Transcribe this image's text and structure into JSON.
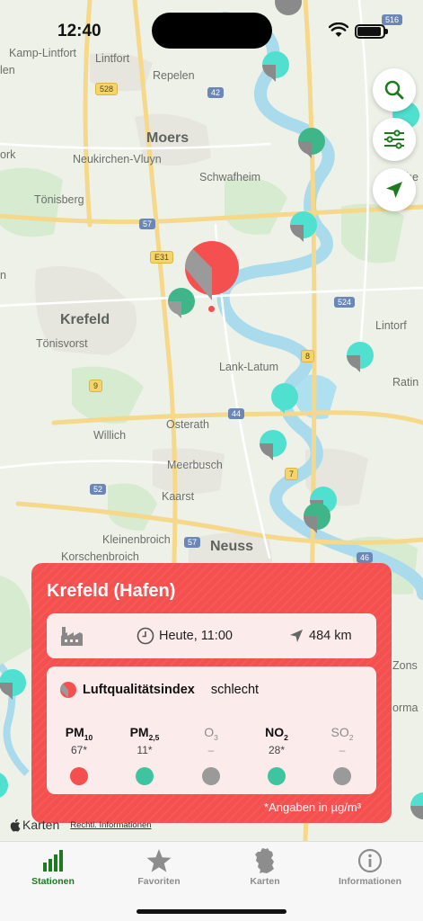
{
  "status_bar": {
    "time": "12:40"
  },
  "map": {
    "places": [
      {
        "name": "Kamp-Lintfort",
        "size": "small"
      },
      {
        "name": "Lintfort",
        "size": "small"
      },
      {
        "name": "Repelen",
        "size": "small"
      },
      {
        "name": "Moers",
        "size": "big"
      },
      {
        "name": "Neukirchen-Vluyn",
        "size": "small"
      },
      {
        "name": "Schwafheim",
        "size": "small"
      },
      {
        "name": "Tönisberg",
        "size": "small"
      },
      {
        "name": "Krefeld",
        "size": "big"
      },
      {
        "name": "Tönisvorst",
        "size": "small"
      },
      {
        "name": "Lank-Latum",
        "size": "small"
      },
      {
        "name": "Lintorf",
        "size": "small"
      },
      {
        "name": "Ratin",
        "size": "small"
      },
      {
        "name": "Osterath",
        "size": "small"
      },
      {
        "name": "Willich",
        "size": "small"
      },
      {
        "name": "Meerbusch",
        "size": "small"
      },
      {
        "name": "Kaarst",
        "size": "small"
      },
      {
        "name": "Kleinenbroich",
        "size": "small"
      },
      {
        "name": "Korschenbroich",
        "size": "small"
      },
      {
        "name": "Neuss",
        "size": "big"
      },
      {
        "name": "Zons",
        "size": "small"
      },
      {
        "name": "ork",
        "size": "small"
      },
      {
        "name": "len",
        "size": "small"
      },
      {
        "name": "n",
        "size": "small"
      },
      {
        "name": "he",
        "size": "small"
      },
      {
        "name": "orma",
        "size": "small"
      }
    ],
    "road_shields": [
      "516",
      "528",
      "42",
      "57",
      "E31",
      "524",
      "9",
      "8",
      "44",
      "7",
      "52",
      "57",
      "46"
    ],
    "attribution": {
      "brand": "Karten",
      "legal": "Rechtl. Informationen"
    }
  },
  "map_buttons": [
    {
      "icon": "search-icon"
    },
    {
      "icon": "filter-sliders-icon"
    },
    {
      "icon": "location-arrow-icon"
    }
  ],
  "station": {
    "name": "Krefeld (Hafen)",
    "type_icon": "factory-icon",
    "time": "Heute, 11:00",
    "distance": "484 km",
    "aqi_label": "Luftqualitätsindex",
    "aqi_value": "schlecht",
    "pollutants": [
      {
        "main": "PM",
        "sub": "10",
        "value": "67*",
        "color": "#f4504f",
        "muted": false
      },
      {
        "main": "PM",
        "sub": "2,5",
        "value": "11*",
        "color": "#3fc4a0",
        "muted": false
      },
      {
        "main": "O",
        "sub": "3",
        "value": "–",
        "color": "#9a9a9a",
        "muted": true
      },
      {
        "main": "NO",
        "sub": "2",
        "value": "28*",
        "color": "#3fc4a0",
        "muted": false
      },
      {
        "main": "SO",
        "sub": "2",
        "value": "–",
        "color": "#9a9a9a",
        "muted": true
      }
    ],
    "units_note": "*Angaben in µg/m³",
    "accent_color": "#f4504f"
  },
  "tabbar": {
    "tabs": [
      {
        "label": "Stationen",
        "icon": "bar-chart-icon",
        "active": true
      },
      {
        "label": "Favoriten",
        "icon": "star-icon",
        "active": false
      },
      {
        "label": "Karten",
        "icon": "germany-map-icon",
        "active": false
      },
      {
        "label": "Informationen",
        "icon": "info-icon",
        "active": false
      }
    ]
  }
}
